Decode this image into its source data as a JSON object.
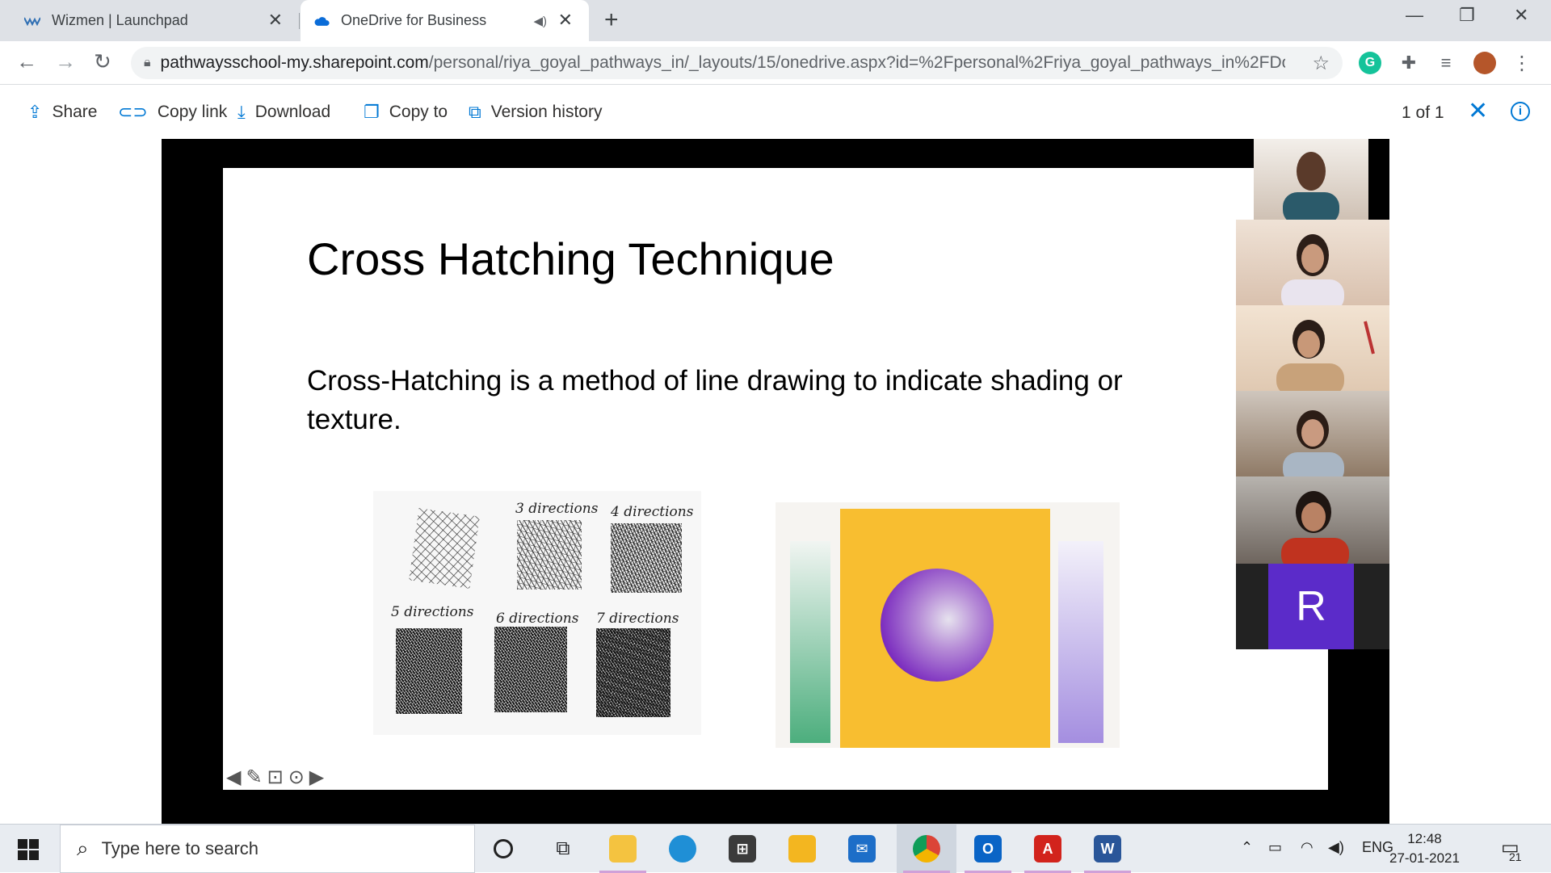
{
  "browser": {
    "tabs": [
      {
        "title": "Wizmen | Launchpad"
      },
      {
        "title": "OneDrive for Business"
      }
    ],
    "url_host": "pathwaysschool-my.sharepoint.com",
    "url_path": "/personal/riya_goyal_pathways_in/_layouts/15/onedrive.aspx?id=%2Fpersonal%2Friya_goyal_pathways_in%2FDo..."
  },
  "commandbar": {
    "share": "Share",
    "copy_link": "Copy link",
    "download": "Download",
    "copy_to": "Copy to",
    "version_history": "Version history",
    "page_count": "1 of 1"
  },
  "slide": {
    "title": "Cross Hatching Technique",
    "body": "Cross-Hatching is a method of line drawing to indicate shading or texture.",
    "hatch_labels": [
      "3 directions",
      "4 directions",
      "5 directions",
      "6 directions",
      "7 directions"
    ]
  },
  "participants": {
    "avatar_letter": "R"
  },
  "taskbar": {
    "search_placeholder": "Type here to search",
    "language": "ENG",
    "time": "12:48",
    "date": "27-01-2021",
    "notification_count": "21"
  },
  "colors": {
    "accent": "#0078d4",
    "avatar": "#5b2bc9",
    "tabstrip": "#dee1e6"
  }
}
